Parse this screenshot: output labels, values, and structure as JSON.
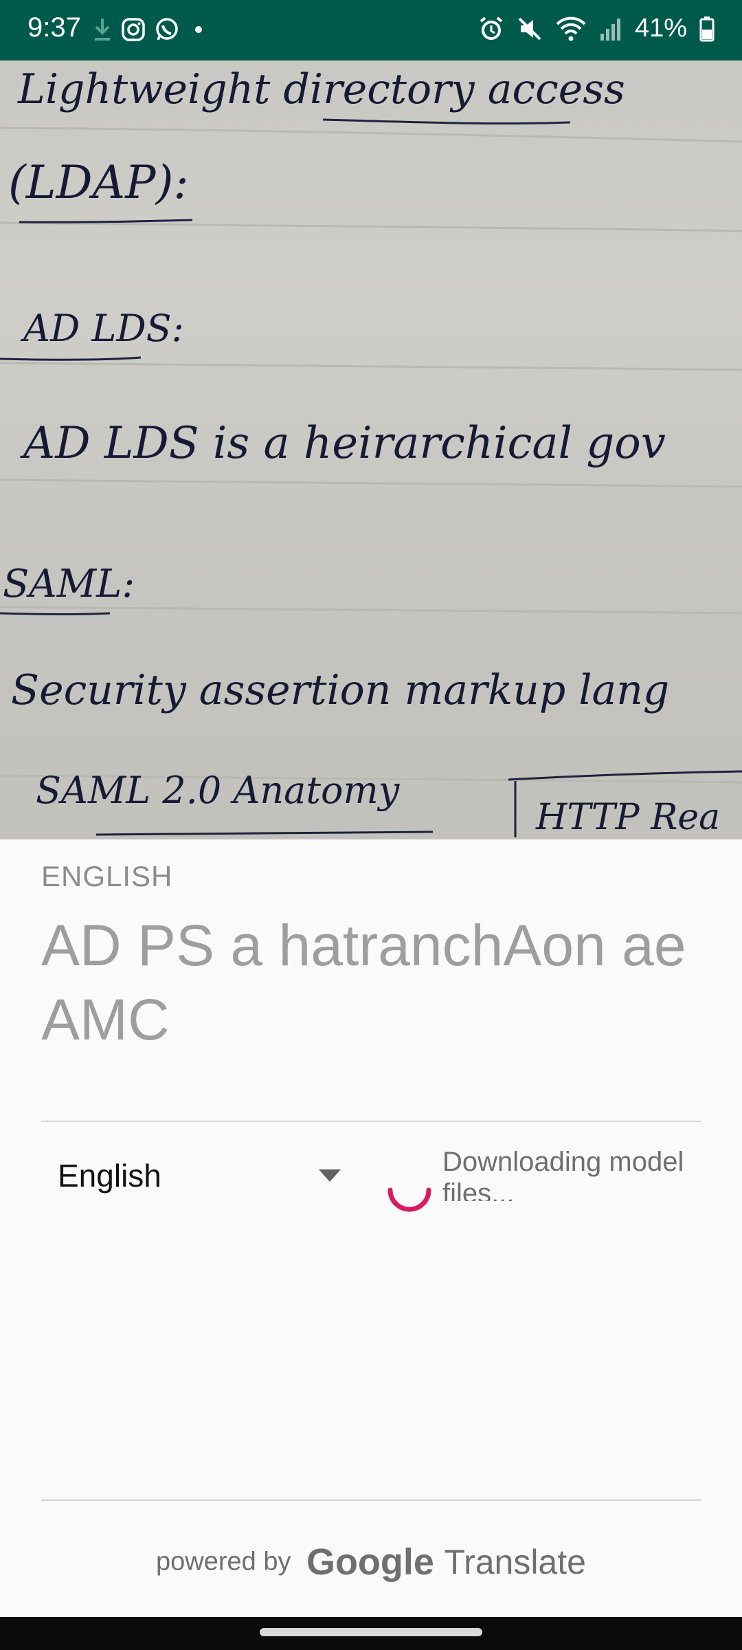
{
  "status_bar": {
    "time": "9:37",
    "battery": "41%",
    "icons": [
      "download-icon",
      "instagram-icon",
      "whatsapp-icon",
      "dot-icon",
      "alarm-icon",
      "mute-icon",
      "wifi-icon",
      "signal-icon",
      "battery-icon"
    ]
  },
  "camera": {
    "handwriting_lines": [
      "Lightweight directory access",
      "(LDAP):",
      "AD LDS:",
      "AD LDS is a heirarchical gov",
      "SAML:",
      "Security assertion markup lang",
      "SAML 2.0 Anatomy",
      "HTTP Rea"
    ]
  },
  "sheet": {
    "source_language": "ENGLISH",
    "recognized_text": "AD PS a hatranchAon ae AMC",
    "target_language": "English",
    "download_status": "Downloading model files..."
  },
  "attribution": {
    "powered_by": "powered by",
    "google": "Google",
    "translate": "Translate"
  },
  "colors": {
    "status_bar": "#005a4c",
    "spinner": "#d81b60",
    "recognized_text": "#9e9e9e"
  }
}
